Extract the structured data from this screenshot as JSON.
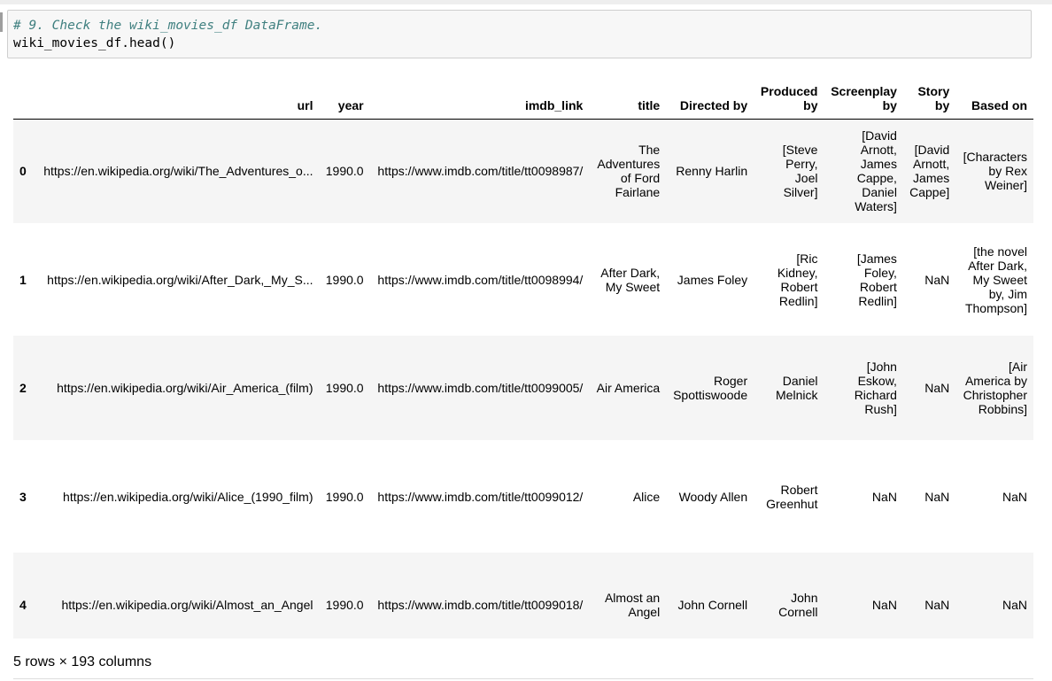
{
  "cell": {
    "comment": "# 9. Check the wiki_movies_df DataFrame.",
    "code": "wiki_movies_df.head()"
  },
  "table": {
    "columns": [
      "",
      "url",
      "year",
      "imdb_link",
      "title",
      "Directed by",
      "Produced by",
      "Screenplay by",
      "Story by",
      "Based on"
    ],
    "rows": [
      [
        "0",
        "https://en.wikipedia.org/wiki/The_Adventures_o...",
        "1990.0",
        "https://www.imdb.com/title/tt0098987/",
        "The Adventures of Ford Fairlane",
        "Renny Harlin",
        "[Steve Perry, Joel Silver]",
        "[David Arnott, James Cappe, Daniel Waters]",
        "[David Arnott, James Cappe]",
        "[Characters by Rex Weiner]"
      ],
      [
        "1",
        "https://en.wikipedia.org/wiki/After_Dark,_My_S...",
        "1990.0",
        "https://www.imdb.com/title/tt0098994/",
        "After Dark, My Sweet",
        "James Foley",
        "[Ric Kidney, Robert Redlin]",
        "[James Foley, Robert Redlin]",
        "NaN",
        "[the novel After Dark, My Sweet by, Jim Thompson]"
      ],
      [
        "2",
        "https://en.wikipedia.org/wiki/Air_America_(film)",
        "1990.0",
        "https://www.imdb.com/title/tt0099005/",
        "Air America",
        "Roger Spottiswoode",
        "Daniel Melnick",
        "[John Eskow, Richard Rush]",
        "NaN",
        "[Air America by Christopher Robbins]"
      ],
      [
        "3",
        "https://en.wikipedia.org/wiki/Alice_(1990_film)",
        "1990.0",
        "https://www.imdb.com/title/tt0099012/",
        "Alice",
        "Woody Allen",
        "Robert Greenhut",
        "NaN",
        "NaN",
        "NaN"
      ],
      [
        "4",
        "https://en.wikipedia.org/wiki/Almost_an_Angel",
        "1990.0",
        "https://www.imdb.com/title/tt0099018/",
        "Almost an Angel",
        "John Cornell",
        "John Cornell",
        "NaN",
        "NaN",
        "NaN"
      ]
    ]
  },
  "footer": {
    "shape": "5 rows × 193 columns"
  }
}
